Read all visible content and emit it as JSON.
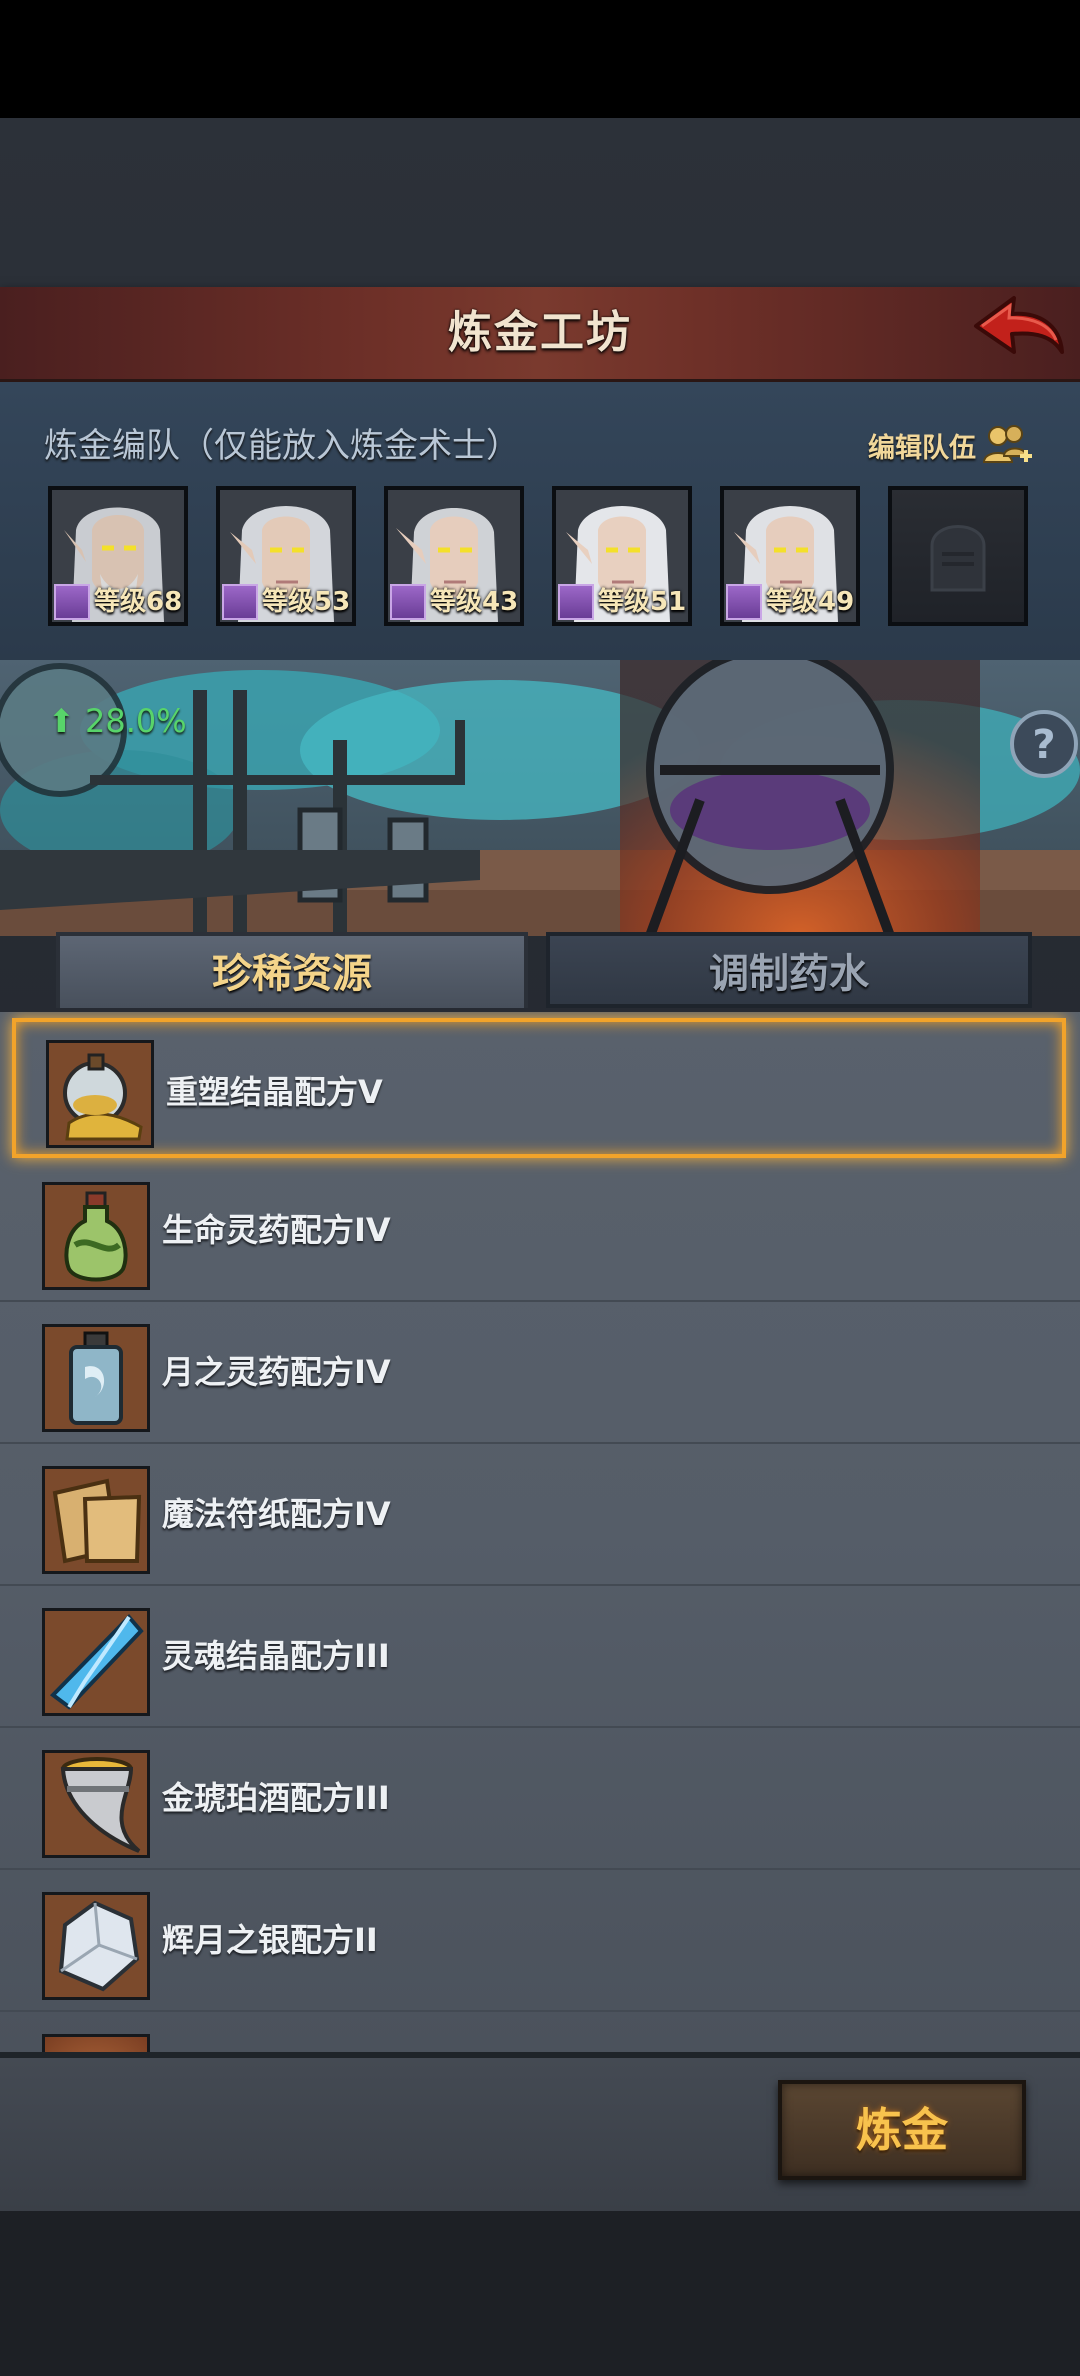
{
  "header": {
    "title": "炼金工坊"
  },
  "team": {
    "title": "炼金编队（仅能放入炼金术士）",
    "edit_label": "编辑队伍",
    "members": [
      {
        "level_text": "等级68"
      },
      {
        "level_text": "等级53"
      },
      {
        "level_text": "等级43"
      },
      {
        "level_text": "等级51"
      },
      {
        "level_text": "等级49"
      }
    ]
  },
  "scene": {
    "rate": "28.0%"
  },
  "tabs": [
    {
      "label": "珍稀资源",
      "active": true
    },
    {
      "label": "调制药水",
      "active": false
    }
  ],
  "items": [
    {
      "name": "重塑结晶配方V",
      "icon": "crystal-flask-icon"
    },
    {
      "name": "生命灵药配方IV",
      "icon": "life-potion-icon"
    },
    {
      "name": "月之灵药配方IV",
      "icon": "moon-potion-icon"
    },
    {
      "name": "魔法符纸配方IV",
      "icon": "paper-scroll-icon"
    },
    {
      "name": "灵魂结晶配方III",
      "icon": "blue-crystal-icon"
    },
    {
      "name": "金琥珀酒配方III",
      "icon": "amber-horn-icon"
    },
    {
      "name": "辉月之银配方II",
      "icon": "silver-ore-icon"
    }
  ],
  "actions": {
    "alchemy_label": "炼金"
  },
  "colors": {
    "accent": "#f2a32a",
    "tab_active_text": "#f4d48a",
    "rate_green": "#58d46a"
  }
}
